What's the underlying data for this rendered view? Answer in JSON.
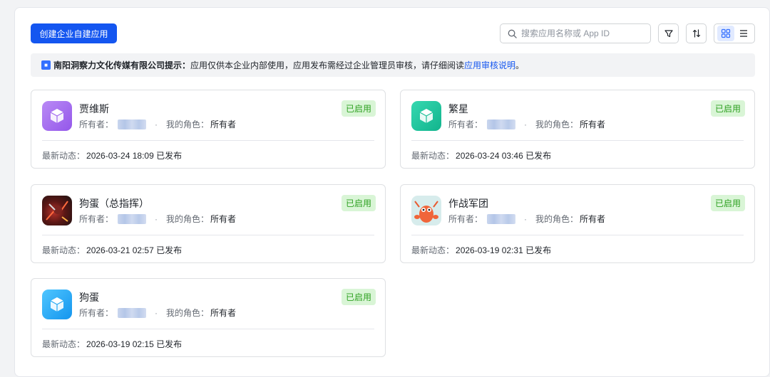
{
  "header": {
    "create_label": "创建企业自建应用",
    "search_placeholder": "搜索应用名称或 App ID"
  },
  "notice": {
    "company": "南阳洞察力文化传媒有限公司提示：",
    "text": "应用仅供本企业内部使用，应用发布需经过企业管理员审核，请仔细阅读 ",
    "link": "应用审核说明",
    "tail": "。"
  },
  "labels": {
    "owner": "所有者：",
    "role": "我的角色：",
    "latest": "最新动态："
  },
  "apps": [
    {
      "name": "贾维斯",
      "status": "已启用",
      "role": "所有者",
      "latest": "2026-03-24 18:09 已发布",
      "icon": "cube-icon",
      "color": "#a56cf0"
    },
    {
      "name": "繁星",
      "status": "已启用",
      "role": "所有者",
      "latest": "2026-03-24 03:46 已发布",
      "icon": "cube-icon",
      "color": "#1fc6a0"
    },
    {
      "name": "狗蛋（总指挥）",
      "status": "已启用",
      "role": "所有者",
      "latest": "2026-03-21 02:57 已发布",
      "icon": "custom-avatar-icon",
      "color": "#2a1a1a"
    },
    {
      "name": "作战军团",
      "status": "已启用",
      "role": "所有者",
      "latest": "2026-03-19 02:31 已发布",
      "icon": "lobster-avatar-icon",
      "color": "#cfe7e9"
    },
    {
      "name": "狗蛋",
      "status": "已启用",
      "role": "所有者",
      "latest": "2026-03-19 02:15 已发布",
      "icon": "cube-icon",
      "color": "#1aa6f2"
    }
  ]
}
